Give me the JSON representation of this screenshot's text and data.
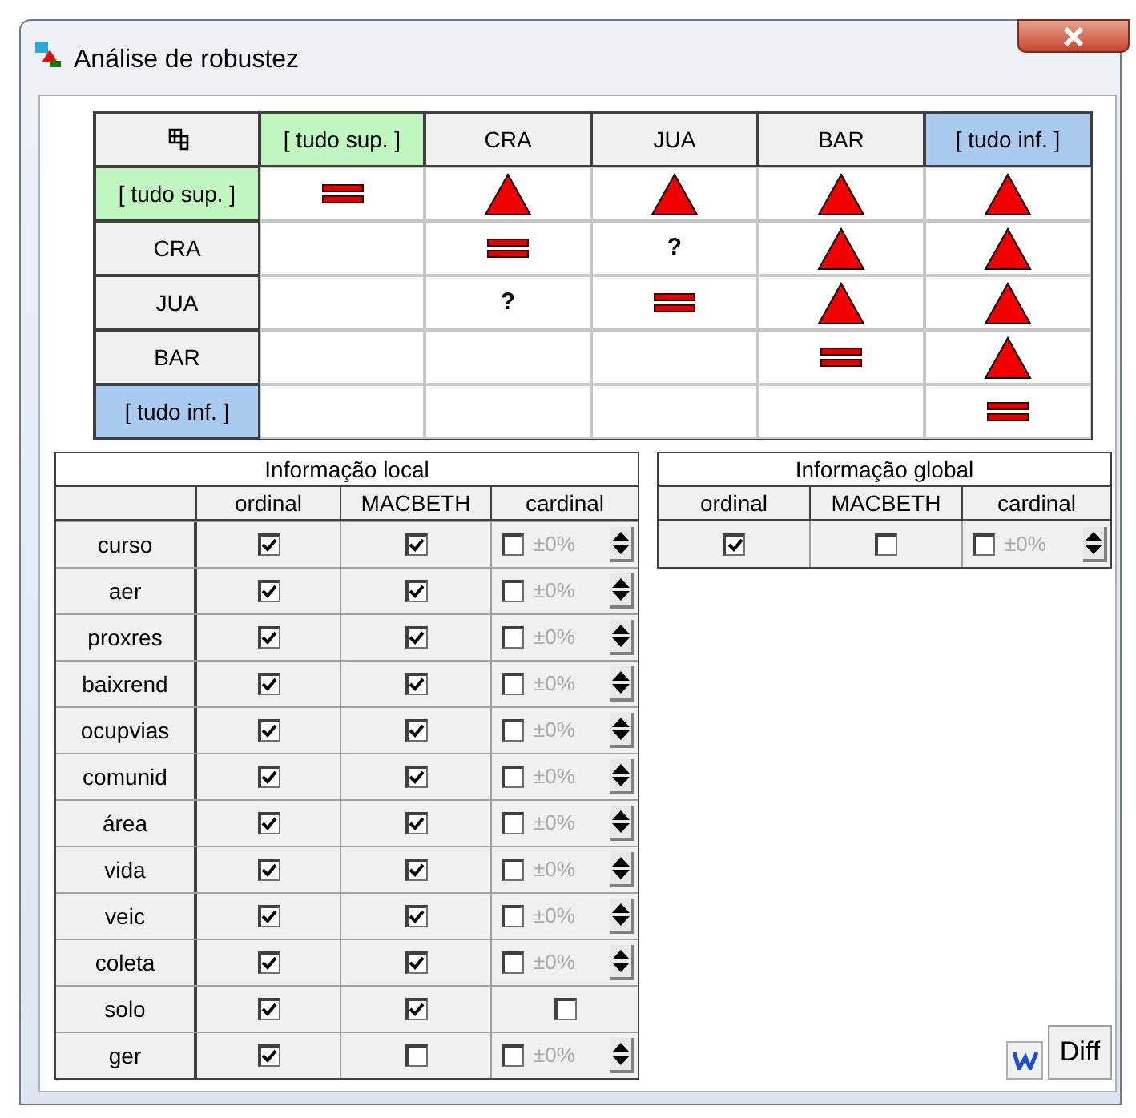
{
  "window": {
    "title": "Análise de robustez"
  },
  "matrix": {
    "columns": [
      {
        "label": "[ tudo sup. ]",
        "color": "#c0f7c0"
      },
      {
        "label": "CRA",
        "color": "#f0f0f0"
      },
      {
        "label": "JUA",
        "color": "#f0f0f0"
      },
      {
        "label": "BAR",
        "color": "#f0f0f0"
      },
      {
        "label": "[ tudo inf. ]",
        "color": "#a9cbf0"
      }
    ],
    "rows": [
      {
        "label": "[ tudo sup. ]",
        "color": "#c0f7c0",
        "cells": [
          {
            "kind": "equal"
          },
          {
            "kind": "triangle"
          },
          {
            "kind": "triangle"
          },
          {
            "kind": "triangle"
          },
          {
            "kind": "triangle"
          }
        ]
      },
      {
        "label": "CRA",
        "color": "#f0f0f0",
        "cells": [
          {
            "kind": "empty"
          },
          {
            "kind": "equal"
          },
          {
            "kind": "text",
            "text": "?"
          },
          {
            "kind": "triangle"
          },
          {
            "kind": "triangle"
          }
        ]
      },
      {
        "label": "JUA",
        "color": "#f0f0f0",
        "cells": [
          {
            "kind": "empty"
          },
          {
            "kind": "text",
            "text": "?"
          },
          {
            "kind": "equal"
          },
          {
            "kind": "triangle"
          },
          {
            "kind": "triangle"
          }
        ]
      },
      {
        "label": "BAR",
        "color": "#f0f0f0",
        "cells": [
          {
            "kind": "empty"
          },
          {
            "kind": "empty"
          },
          {
            "kind": "empty"
          },
          {
            "kind": "equal"
          },
          {
            "kind": "triangle"
          }
        ]
      },
      {
        "label": "[ tudo inf. ]",
        "color": "#a9cbf0",
        "cells": [
          {
            "kind": "empty"
          },
          {
            "kind": "empty"
          },
          {
            "kind": "empty"
          },
          {
            "kind": "empty"
          },
          {
            "kind": "equal"
          }
        ]
      }
    ]
  },
  "local": {
    "title": "Informação local",
    "columns": [
      "ordinal",
      "MACBETH",
      "cardinal"
    ],
    "rows": [
      {
        "label": "curso",
        "ordinal": true,
        "macbeth": true,
        "cardinal": {
          "kind": "spinner",
          "checked": false,
          "value": "±0%"
        }
      },
      {
        "label": "aer",
        "ordinal": true,
        "macbeth": true,
        "cardinal": {
          "kind": "spinner",
          "checked": false,
          "value": "±0%"
        }
      },
      {
        "label": "proxres",
        "ordinal": true,
        "macbeth": true,
        "cardinal": {
          "kind": "spinner",
          "checked": false,
          "value": "±0%"
        }
      },
      {
        "label": "baixrend",
        "ordinal": true,
        "macbeth": true,
        "cardinal": {
          "kind": "spinner",
          "checked": false,
          "value": "±0%"
        }
      },
      {
        "label": "ocupvias",
        "ordinal": true,
        "macbeth": true,
        "cardinal": {
          "kind": "spinner",
          "checked": false,
          "value": "±0%"
        }
      },
      {
        "label": "comunid",
        "ordinal": true,
        "macbeth": true,
        "cardinal": {
          "kind": "spinner",
          "checked": false,
          "value": "±0%"
        }
      },
      {
        "label": "área",
        "ordinal": true,
        "macbeth": true,
        "cardinal": {
          "kind": "spinner",
          "checked": false,
          "value": "±0%"
        }
      },
      {
        "label": "vida",
        "ordinal": true,
        "macbeth": true,
        "cardinal": {
          "kind": "spinner",
          "checked": false,
          "value": "±0%"
        }
      },
      {
        "label": "veic",
        "ordinal": true,
        "macbeth": true,
        "cardinal": {
          "kind": "spinner",
          "checked": false,
          "value": "±0%"
        }
      },
      {
        "label": "coleta",
        "ordinal": true,
        "macbeth": true,
        "cardinal": {
          "kind": "spinner",
          "checked": false,
          "value": "±0%"
        }
      },
      {
        "label": "solo",
        "ordinal": true,
        "macbeth": true,
        "cardinal": {
          "kind": "compact",
          "checked": false
        }
      },
      {
        "label": "ger",
        "ordinal": true,
        "macbeth": false,
        "cardinal": {
          "kind": "spinner",
          "checked": false,
          "value": "±0%"
        }
      }
    ]
  },
  "global": {
    "title": "Informação global",
    "columns": [
      "ordinal",
      "MACBETH",
      "cardinal"
    ],
    "row": {
      "ordinal": true,
      "macbeth": false,
      "cardinal": {
        "kind": "spinner",
        "checked": false,
        "value": "±0%"
      }
    }
  },
  "buttons": {
    "diff": "Diff"
  }
}
